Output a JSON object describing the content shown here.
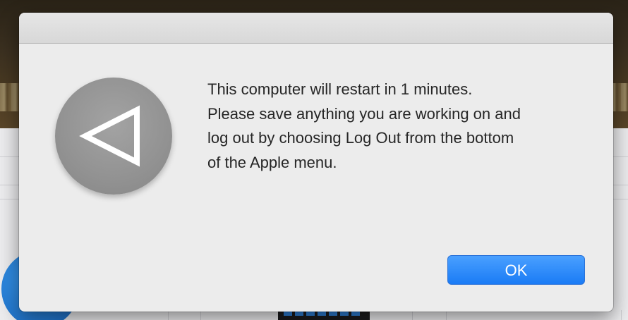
{
  "dialog": {
    "message": "This computer will restart in 1 minutes.\nPlease save anything you are working on and\nlog out by choosing Log Out from the bottom\nof the Apple menu.",
    "ok_label": "OK",
    "icon": "back-arrow-triangle-icon"
  },
  "colors": {
    "dialog_background": "#ececec",
    "button_blue": "#1a7bf5",
    "icon_circle": "#929292"
  }
}
